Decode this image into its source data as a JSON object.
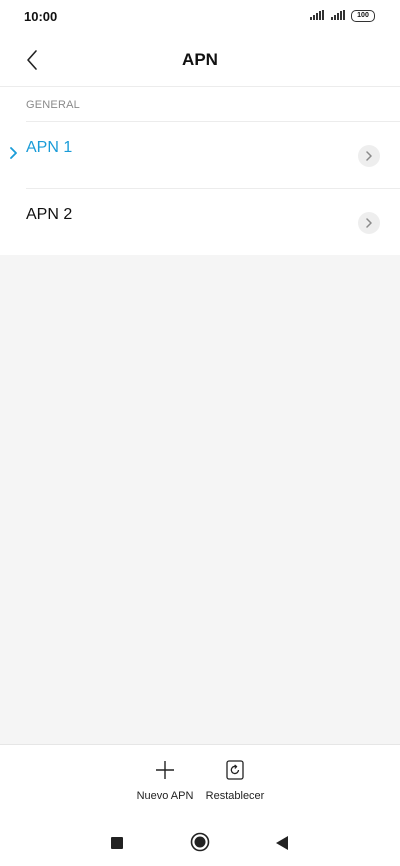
{
  "status_bar": {
    "time": "10:00",
    "battery": "100"
  },
  "header": {
    "title": "APN"
  },
  "section": {
    "title": "GENERAL"
  },
  "apns": [
    {
      "label": "APN 1",
      "selected": true
    },
    {
      "label": "APN 2",
      "selected": false
    }
  ],
  "actions": {
    "new_label": "Nuevo APN",
    "reset_label": "Restablecer"
  },
  "colors": {
    "accent": "#1a9cd8",
    "background": "#f5f5f5"
  },
  "icons": {
    "back": "chevron-left-icon",
    "row_arrow": "chevron-right-icon",
    "new": "plus-icon",
    "reset": "reset-icon",
    "nav_recents": "square-icon",
    "nav_home": "circle-icon",
    "nav_back": "triangle-left-icon"
  }
}
